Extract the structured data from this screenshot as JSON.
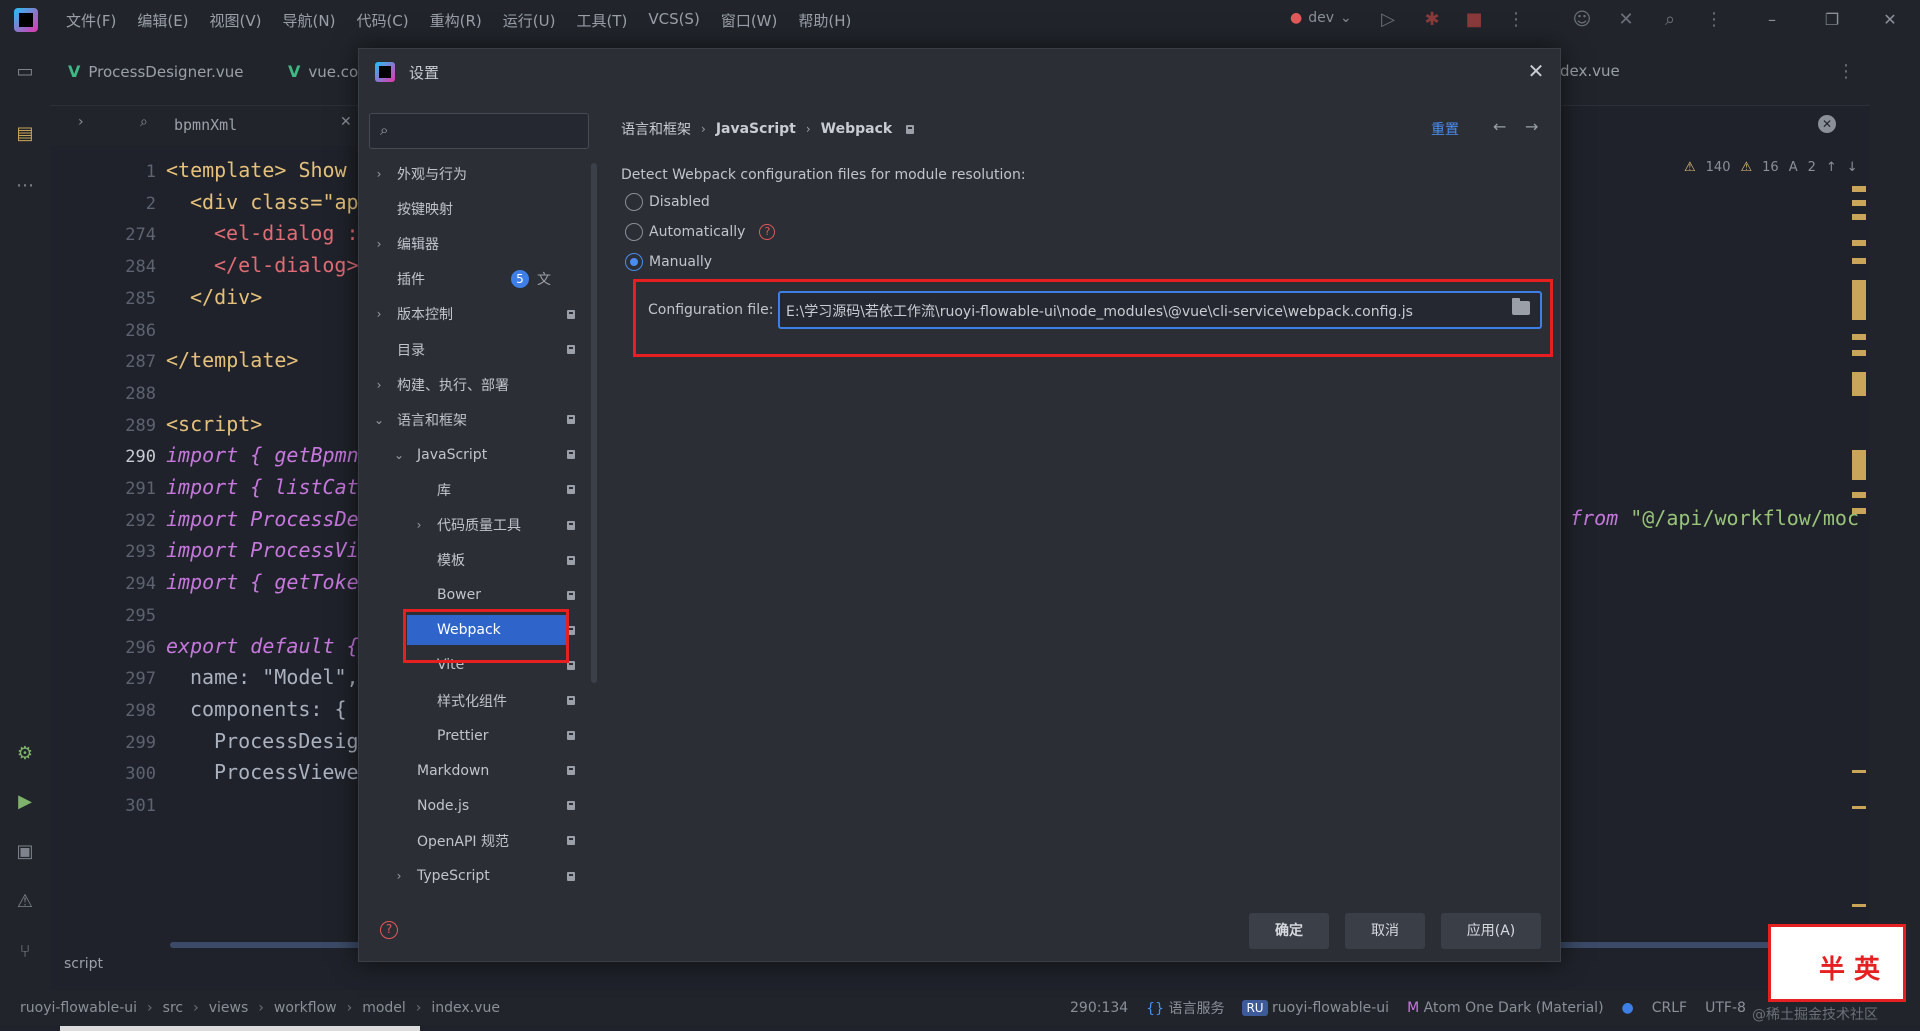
{
  "menubar": {
    "items": [
      "文件(F)",
      "编辑(E)",
      "视图(V)",
      "导航(N)",
      "代码(C)",
      "重构(R)",
      "运行(U)",
      "工具(T)",
      "VCS(S)",
      "窗口(W)",
      "帮助(H)"
    ],
    "branch": "dev"
  },
  "editor_tabs": {
    "tab1": "ProcessDesigner.vue",
    "tab2": "vue.co",
    "tab3": "dex.vue"
  },
  "search": {
    "query": "bpmnXml"
  },
  "code": {
    "lines": [
      {
        "no": "1",
        "text": "<template>  Show c"
      },
      {
        "no": "2",
        "text": "<div class=\"ap"
      },
      {
        "no": "274",
        "text": "<el-dialog :"
      },
      {
        "no": "284",
        "text": "</el-dialog>"
      },
      {
        "no": "285",
        "text": "</div>"
      },
      {
        "no": "286",
        "text": ""
      },
      {
        "no": "287",
        "text": "</template>"
      },
      {
        "no": "288",
        "text": ""
      },
      {
        "no": "289",
        "text": "<script>"
      },
      {
        "no": "290",
        "text": "import { getBpmn"
      },
      {
        "no": "291",
        "text": "import { listCat"
      },
      {
        "no": "292",
        "text": "import ProcessDe"
      },
      {
        "no": "293",
        "text": "import ProcessVi"
      },
      {
        "no": "294",
        "text": "import { getToke"
      },
      {
        "no": "295",
        "text": ""
      },
      {
        "no": "296",
        "text": "export default {"
      },
      {
        "no": "297",
        "text": "name: \"Model\","
      },
      {
        "no": "298",
        "text": "components: {"
      },
      {
        "no": "299",
        "text": "ProcessDesig"
      },
      {
        "no": "300",
        "text": "ProcessViewe"
      },
      {
        "no": "301",
        "text": ""
      }
    ],
    "import_tail_kw": "from",
    "import_tail_str": "\"@/api/workflow/moc",
    "problems": {
      "warnings": "140",
      "weak": "16",
      "typos": "2"
    }
  },
  "dialog": {
    "title": "设置",
    "search_placeholder": "",
    "tree": [
      {
        "label": "外观与行为",
        "arrow": "›",
        "indent": 0,
        "pin": false
      },
      {
        "label": "按键映射",
        "arrow": "",
        "indent": 0,
        "pin": false
      },
      {
        "label": "编辑器",
        "arrow": "›",
        "indent": 0,
        "pin": false
      },
      {
        "label": "插件",
        "arrow": "",
        "indent": 0,
        "pin": false,
        "badge": "5"
      },
      {
        "label": "版本控制",
        "arrow": "›",
        "indent": 0,
        "pin": true
      },
      {
        "label": "目录",
        "arrow": "",
        "indent": 0,
        "pin": true
      },
      {
        "label": "构建、执行、部署",
        "arrow": "›",
        "indent": 0,
        "pin": false
      },
      {
        "label": "语言和框架",
        "arrow": "⌄",
        "indent": 0,
        "pin": true
      },
      {
        "label": "JavaScript",
        "arrow": "⌄",
        "indent": 1,
        "pin": true
      },
      {
        "label": "库",
        "arrow": "",
        "indent": 2,
        "pin": true
      },
      {
        "label": "代码质量工具",
        "arrow": "›",
        "indent": 2,
        "pin": true
      },
      {
        "label": "模板",
        "arrow": "",
        "indent": 2,
        "pin": true
      },
      {
        "label": "Bower",
        "arrow": "",
        "indent": 2,
        "pin": true
      },
      {
        "label": "Webpack",
        "arrow": "",
        "indent": 2,
        "pin": true,
        "selected": true
      },
      {
        "label": "Vite",
        "arrow": "",
        "indent": 2,
        "pin": true
      },
      {
        "label": "样式化组件",
        "arrow": "",
        "indent": 2,
        "pin": true
      },
      {
        "label": "Prettier",
        "arrow": "",
        "indent": 2,
        "pin": true
      },
      {
        "label": "Markdown",
        "arrow": "",
        "indent": 1,
        "pin": true
      },
      {
        "label": "Node.js",
        "arrow": "",
        "indent": 1,
        "pin": true
      },
      {
        "label": "OpenAPI 规范",
        "arrow": "",
        "indent": 1,
        "pin": true
      },
      {
        "label": "TypeScript",
        "arrow": "›",
        "indent": 1,
        "pin": true
      }
    ],
    "breadcrumb": [
      "语言和框架",
      "JavaScript",
      "Webpack"
    ],
    "reset_label": "重置",
    "detect_label": "Detect Webpack configuration files for module resolution:",
    "radios": [
      {
        "label": "Disabled",
        "checked": false
      },
      {
        "label": "Automatically",
        "checked": false
      },
      {
        "label": "Manually",
        "checked": true
      }
    ],
    "config_label": "Configuration file:",
    "config_value": "E:\\学习源码\\若依工作流\\ruoyi-flowable-ui\\node_modules\\@vue\\cli-service\\webpack.config.js",
    "buttons": {
      "ok": "确定",
      "cancel": "取消",
      "apply": "应用(A)"
    }
  },
  "script_label": "script",
  "statusbar": {
    "crumbs": [
      "ruoyi-flowable-ui",
      "src",
      "views",
      "workflow",
      "model",
      "index.vue"
    ],
    "position": "290:134",
    "lang_service": "语言服务",
    "project_badge": "RU",
    "project": "ruoyi-flowable-ui",
    "theme": "Atom One Dark (Material)",
    "line_sep": "CRLF",
    "encoding": "UTF-8"
  },
  "sticker": {
    "text": "半 英"
  },
  "watermark": "@稀土掘金技术社区",
  "colors": {
    "accent": "#3d7fe6",
    "highlight_red": "#e62020",
    "selected": "#2f65ca"
  }
}
